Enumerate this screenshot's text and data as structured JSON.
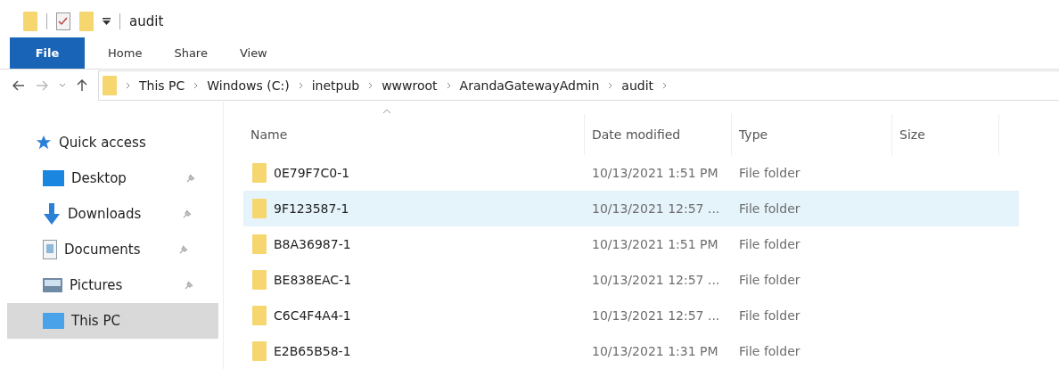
{
  "window": {
    "title": "audit"
  },
  "ribbon_tabs": [
    {
      "label": "File",
      "selected": true
    },
    {
      "label": "Home",
      "selected": false
    },
    {
      "label": "Share",
      "selected": false
    },
    {
      "label": "View",
      "selected": false
    }
  ],
  "address_bar": {
    "path": [
      "This PC",
      "Windows (C:)",
      "inetpub",
      "wwwroot",
      "ArandaGatewayAdmin",
      "audit"
    ]
  },
  "sidebar": {
    "items": [
      {
        "label": "Quick access",
        "kind": "star",
        "selected": false,
        "children": [
          {
            "label": "Desktop",
            "kind": "desktop",
            "selected": false
          },
          {
            "label": "Downloads",
            "kind": "download",
            "selected": false
          },
          {
            "label": "Documents",
            "kind": "documents",
            "selected": false
          },
          {
            "label": "Pictures",
            "kind": "pictures",
            "selected": false
          }
        ]
      },
      {
        "label": "This PC",
        "kind": "pc",
        "selected": true
      }
    ]
  },
  "table": {
    "columns": [
      "Name",
      "Date modified",
      "Type",
      "Size"
    ],
    "rows": [
      {
        "name": "0E79F7C0-1",
        "date": "10/13/2021 1:51 PM",
        "type": "File folder",
        "selected": false
      },
      {
        "name": "9F123587-1",
        "date": "10/13/2021 12:57 ...",
        "type": "File folder",
        "selected": true
      },
      {
        "name": "B8A36987-1",
        "date": "10/13/2021 1:51 PM",
        "type": "File folder",
        "selected": false
      },
      {
        "name": "BE838EAC-1",
        "date": "10/13/2021 12:57 ...",
        "type": "File folder",
        "selected": false
      },
      {
        "name": "C6C4F4A4-1",
        "date": "10/13/2021 12:57 ...",
        "type": "File folder",
        "selected": false
      },
      {
        "name": "E2B65B58-1",
        "date": "10/13/2021 1:31 PM",
        "type": "File folder",
        "selected": false
      }
    ]
  }
}
